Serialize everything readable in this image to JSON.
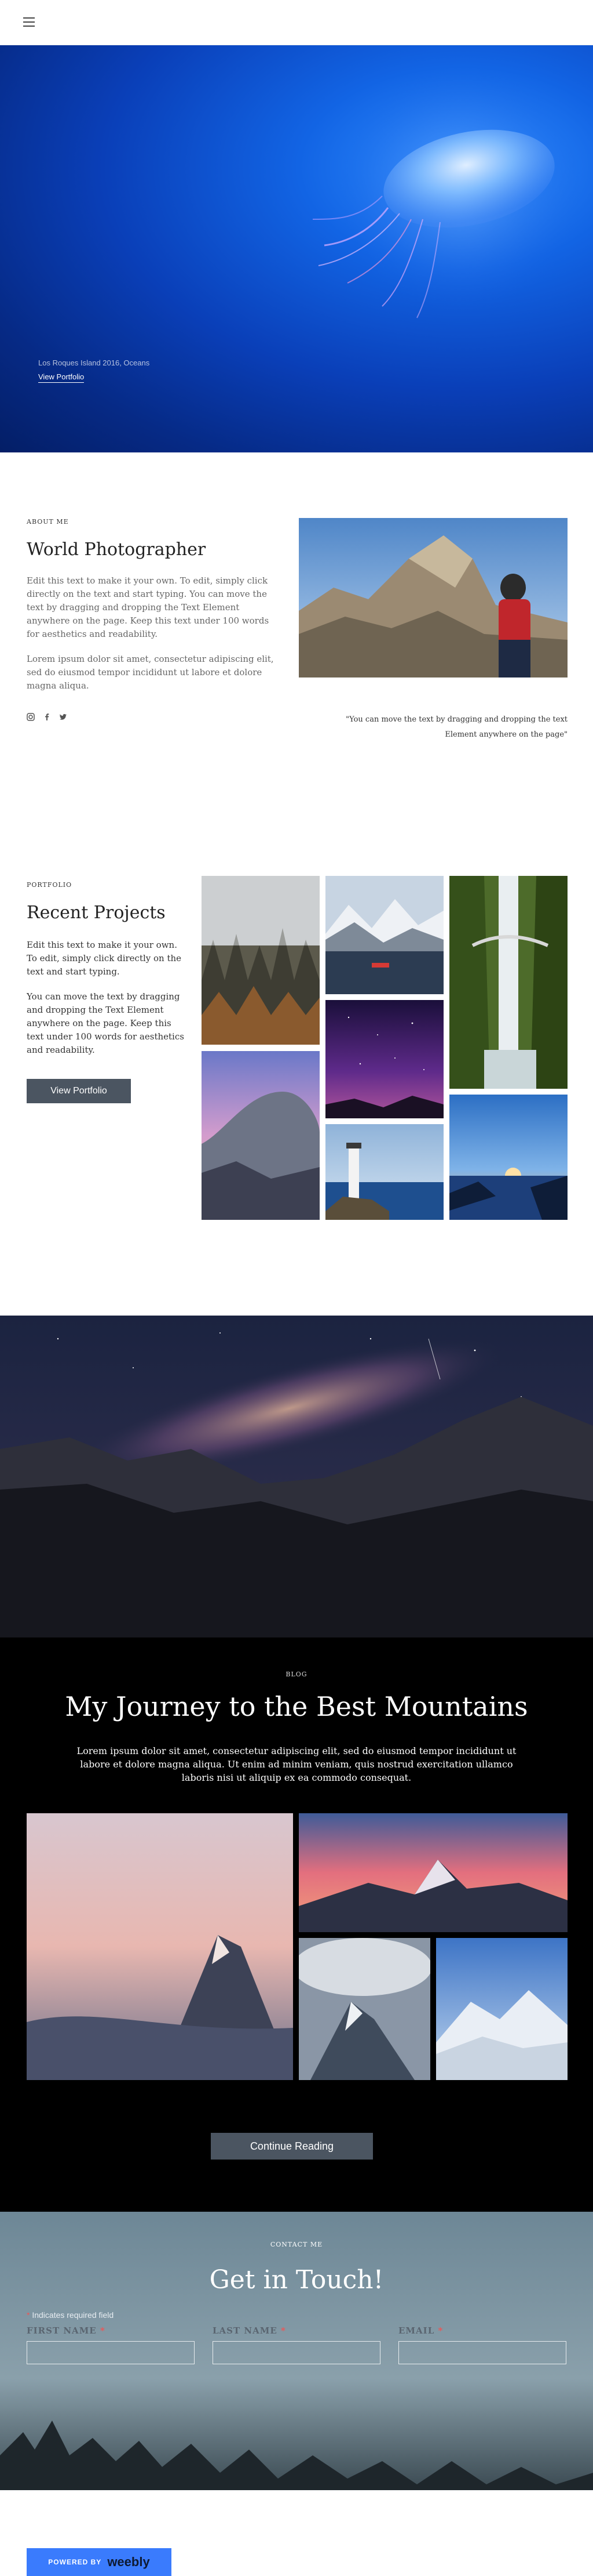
{
  "header": {
    "menu_icon": "hamburger-menu-icon"
  },
  "hero": {
    "caption": "Los Roques Island 2016, Oceans",
    "link_label": "View Portfolio"
  },
  "about": {
    "eyebrow": "ABOUT ME",
    "title": "World Photographer",
    "paragraph1": "Edit this text to make it your own. To edit, simply click directly on the text and start typing. You can move the text by dragging and dropping the Text Element anywhere on the page. Keep this text under 100 words for aesthetics and readability.",
    "paragraph2": "Lorem ipsum dolor sit amet, consectetur adipiscing elit, sed do eiusmod tempor incididunt ut labore et dolore magna aliqua.",
    "quote": "\"You can move the text by dragging and dropping the text Element anywhere on the page\"",
    "social_icons": [
      "instagram-icon",
      "facebook-icon",
      "twitter-icon"
    ]
  },
  "portfolio": {
    "eyebrow": "PORTFOLIO",
    "title": "Recent Projects",
    "paragraph1": "Edit this text to make it your own. To edit, simply click directly on the text and start typing.",
    "paragraph2": "You can move the text by dragging and dropping the Text Element anywhere on the page. Keep this text under 100 words for aesthetics and readability.",
    "button_label": "View Portfolio"
  },
  "blog": {
    "eyebrow": "BLOG",
    "title": "My Journey to the Best Mountains",
    "text": "Lorem ipsum dolor sit amet, consectetur adipiscing elit, sed do eiusmod tempor incididunt ut labore et dolore magna aliqua. Ut enim ad minim veniam, quis nostrud exercitation ullamco laboris nisi ut aliquip ex ea commodo consequat.",
    "button_label": "Continue Reading"
  },
  "contact": {
    "eyebrow": "CONTACT ME",
    "title": "Get in Touch!",
    "required_note": "Indicates required field",
    "fields": [
      {
        "label": "FIRST NAME",
        "value": ""
      },
      {
        "label": "LAST NAME",
        "value": ""
      },
      {
        "label": "EMAIL",
        "value": ""
      }
    ]
  },
  "footer": {
    "powered_by": "POWERED BY",
    "brand": "weebly"
  }
}
